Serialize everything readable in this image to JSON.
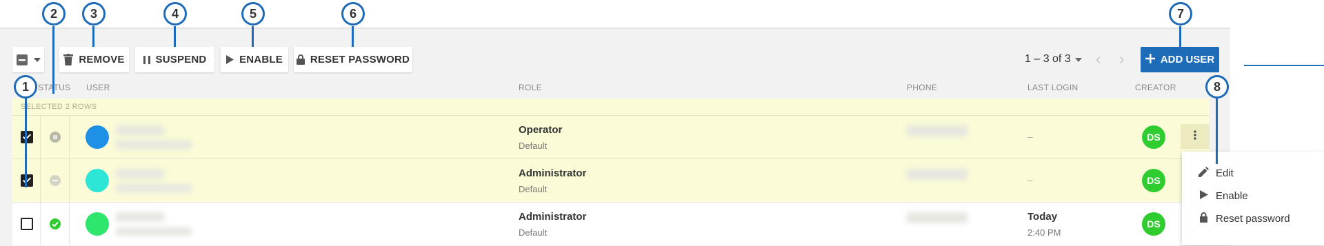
{
  "toolbar": {
    "remove_label": "REMOVE",
    "suspend_label": "SUSPEND",
    "enable_label": "ENABLE",
    "reset_password_label": "RESET PASSWORD",
    "pager_text": "1 – 3 of 3",
    "add_user_label": "ADD USER"
  },
  "columns": {
    "status": "STATUS",
    "user": "USER",
    "role": "ROLE",
    "phone": "PHONE",
    "last_login": "LAST LOGIN",
    "creator": "CREATOR"
  },
  "selection_text": "SELECTED 2 ROWS",
  "rows": [
    {
      "selected": true,
      "status": "suspended",
      "avatar_color": "#1e90e6",
      "role": "Operator",
      "role_sub": "Default",
      "last_login": "–",
      "last_login_time": "",
      "creator": "DS"
    },
    {
      "selected": true,
      "status": "disabled",
      "avatar_color": "#2ee6d6",
      "role": "Administrator",
      "role_sub": "Default",
      "last_login": "–",
      "last_login_time": "",
      "creator": "DS"
    },
    {
      "selected": false,
      "status": "active",
      "avatar_color": "#2ee66b",
      "role": "Administrator",
      "role_sub": "Default",
      "last_login": "Today",
      "last_login_time": "2:40 PM",
      "creator": "DS"
    }
  ],
  "context_menu": [
    {
      "label": "Edit",
      "icon": "pencil-icon"
    },
    {
      "label": "Enable",
      "icon": "play-icon"
    },
    {
      "label": "Reset password",
      "icon": "lock-icon"
    }
  ],
  "callouts": [
    "1",
    "2",
    "3",
    "4",
    "5",
    "6",
    "7",
    "8"
  ],
  "colors": {
    "accent": "#1e6bb8",
    "selected_row": "#fbfbd7",
    "creator_badge": "#2ecc2e"
  }
}
